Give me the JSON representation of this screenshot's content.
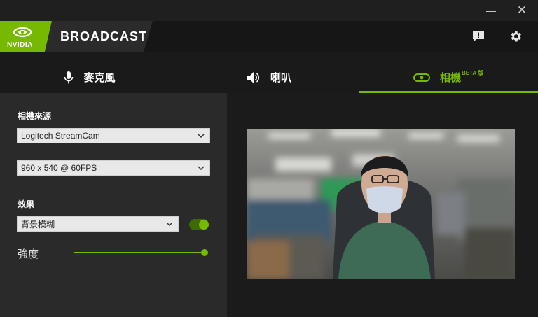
{
  "window": {
    "minimize_glyph": "—",
    "close_glyph": "✕"
  },
  "brand": {
    "logo_text": "NVIDIA",
    "title": "BROADCAST",
    "accent": "#76b900"
  },
  "header_icons": [
    "feedback-icon",
    "gear-icon"
  ],
  "tabs": [
    {
      "label": "麥克風",
      "icon": "microphone-icon",
      "active": false
    },
    {
      "label": "喇叭",
      "icon": "speaker-icon",
      "active": false
    },
    {
      "label": "相機",
      "icon": "webcam-icon",
      "badge": "BETA 版",
      "active": true
    }
  ],
  "camera": {
    "source_label": "相機來源",
    "source_value": "Logitech StreamCam",
    "resolution_value": "960 x 540 @ 60FPS",
    "effect_label": "效果",
    "effect_value": "背景模糊",
    "effect_enabled": true,
    "strength_label": "強度",
    "strength_value": 1.0
  }
}
